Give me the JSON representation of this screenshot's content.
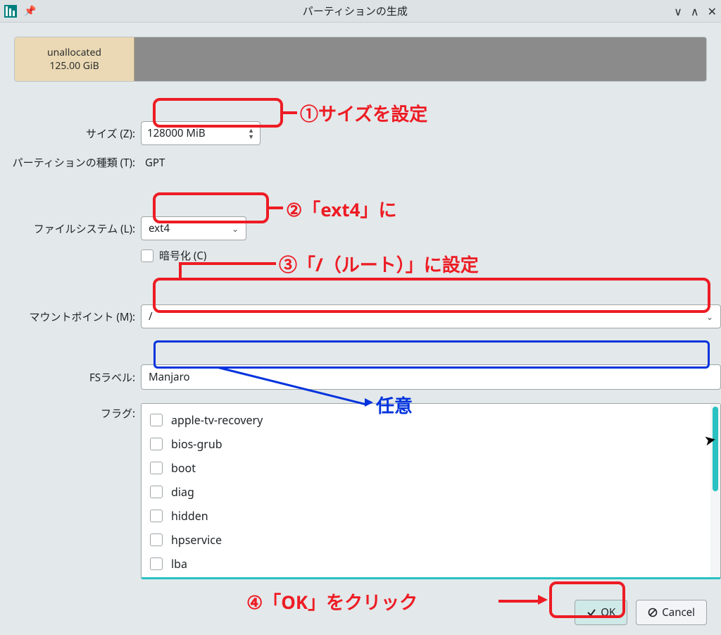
{
  "window": {
    "title": "パーティションの生成"
  },
  "partition_bar": {
    "unalloc_label": "unallocated",
    "unalloc_size": "125.00 GiB"
  },
  "labels": {
    "size": "サイズ (Z):",
    "ptype": "パーティションの種類 (T):",
    "fs": "ファイルシステム (L):",
    "encrypt": "暗号化 (C)",
    "mount": "マウントポイント (M):",
    "fslabel": "FSラベル:",
    "flags": "フラグ:"
  },
  "values": {
    "size": "128000 MiB",
    "ptype": "GPT",
    "fs": "ext4",
    "mount": "/",
    "fslabel": "Manjaro"
  },
  "flags": [
    "apple-tv-recovery",
    "bios-grub",
    "boot",
    "diag",
    "hidden",
    "hpservice",
    "lba"
  ],
  "buttons": {
    "ok": "OK",
    "cancel": "Cancel"
  },
  "annotations": {
    "a1": "①サイズを設定",
    "a2": "②「ext4」に",
    "a3": "③「/（ルート）」に設定",
    "a4": "④「OK」をクリック",
    "opt": "任意"
  }
}
